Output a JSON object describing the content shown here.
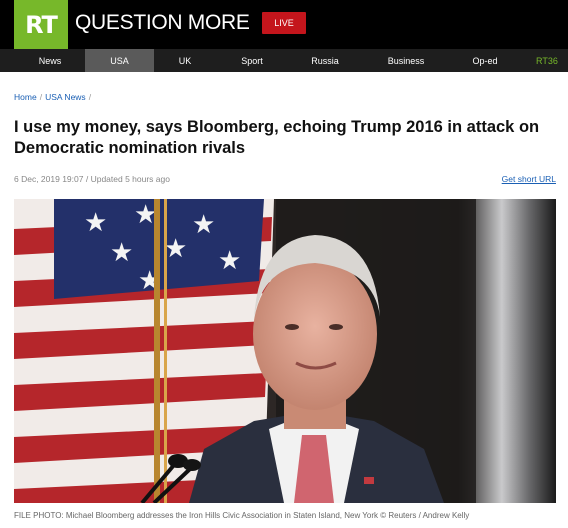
{
  "header": {
    "logo_text": "RT",
    "tagline": "QUESTION MORE",
    "live_label": "LIVE",
    "brand_color": "#77b82a",
    "live_color": "#c4151c"
  },
  "nav": {
    "items": [
      {
        "label": "News"
      },
      {
        "label": "USA",
        "active": true
      },
      {
        "label": "UK"
      },
      {
        "label": "Sport"
      },
      {
        "label": "Russia"
      },
      {
        "label": "Business"
      },
      {
        "label": "Op-ed"
      },
      {
        "label": "RT36"
      }
    ]
  },
  "breadcrumbs": {
    "home": "Home",
    "section": "USA News",
    "separator": "/"
  },
  "article": {
    "title": "I use my money, says Bloomberg, echoing Trump 2016 in attack on Democratic nomination rivals",
    "published": "6 Dec, 2019 19:07",
    "updated": "/ Updated 5 hours ago",
    "short_url_label": "Get short URL",
    "caption": "FILE PHOTO: Michael Bloomberg addresses the Iron Hills Civic Association in Staten Island, New York © Reuters / Andrew Kelly"
  }
}
